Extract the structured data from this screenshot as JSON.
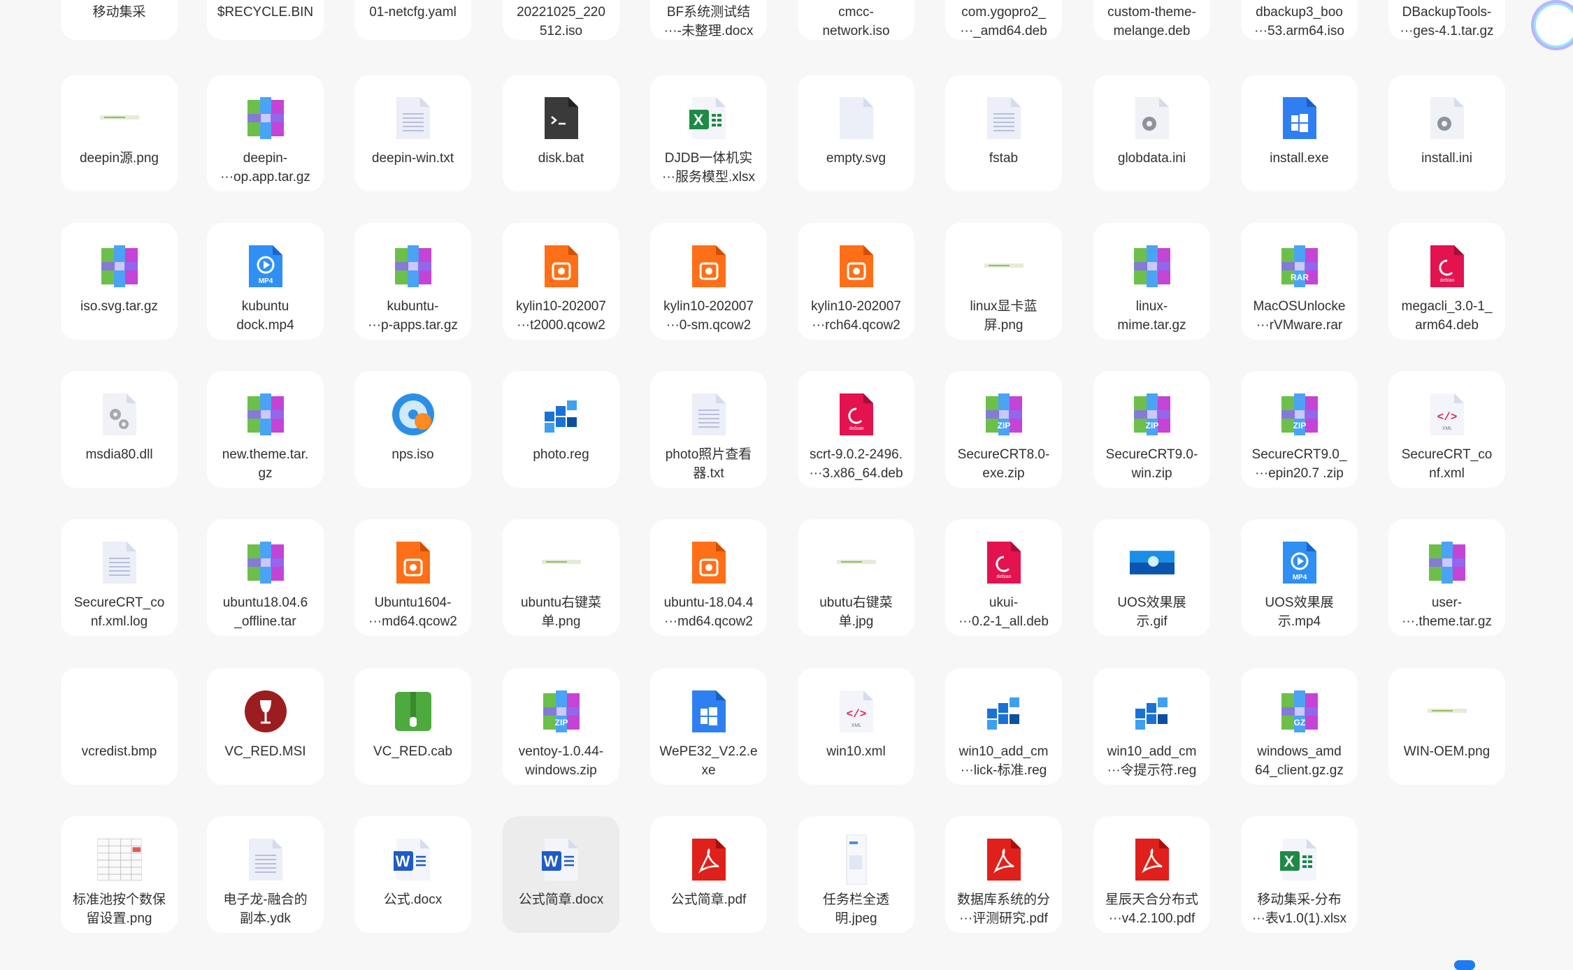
{
  "files": [
    {
      "name": "移动集采",
      "icon": "folder-icon"
    },
    {
      "name": "$RECYCLE.BIN",
      "icon": "folder-icon"
    },
    {
      "name": "01-netcfg.yaml",
      "icon": "text-file-icon"
    },
    {
      "name": "20221025_220\n512.iso",
      "icon": "disc-icon"
    },
    {
      "name": "BF系统测试结\n···-未整理.docx",
      "icon": "word-icon"
    },
    {
      "name": "cmcc-\nnetwork.iso",
      "icon": "disc-icon"
    },
    {
      "name": "com.ygopro2_\n···_amd64.deb",
      "icon": "deb-icon"
    },
    {
      "name": "custom-theme-\nmelange.deb",
      "icon": "deb-icon"
    },
    {
      "name": "dbackup3_boo\n···53.arm64.iso",
      "icon": "disc-icon"
    },
    {
      "name": "DBackupTools-\n···ges-4.1.tar.gz",
      "icon": "archive-icon"
    },
    {
      "name": "deepin源.png",
      "icon": "image-thumb-icon"
    },
    {
      "name": "deepin-\n···op.app.tar.gz",
      "icon": "archive-icon"
    },
    {
      "name": "deepin-win.txt",
      "icon": "text-file-icon"
    },
    {
      "name": "disk.bat",
      "icon": "terminal-icon"
    },
    {
      "name": "DJDB一体机实\n···服务模型.xlsx",
      "icon": "excel-icon"
    },
    {
      "name": "empty.svg",
      "icon": "blank-file-icon"
    },
    {
      "name": "fstab",
      "icon": "text-file-icon"
    },
    {
      "name": "globdata.ini",
      "icon": "config-icon"
    },
    {
      "name": "install.exe",
      "icon": "windows-exe-icon"
    },
    {
      "name": "install.ini",
      "icon": "config-icon"
    },
    {
      "name": "iso.svg.tar.gz",
      "icon": "archive-icon"
    },
    {
      "name": "kubuntu\ndock.mp4",
      "icon": "mp4-icon"
    },
    {
      "name": "kubuntu-\n···p-apps.tar.gz",
      "icon": "archive-icon"
    },
    {
      "name": "kylin10-202007\n···t2000.qcow2",
      "icon": "disk-image-icon"
    },
    {
      "name": "kylin10-202007\n···0-sm.qcow2",
      "icon": "disk-image-icon"
    },
    {
      "name": "kylin10-202007\n···rch64.qcow2",
      "icon": "disk-image-icon"
    },
    {
      "name": "linux显卡蓝\n屏.png",
      "icon": "image-thumb-icon"
    },
    {
      "name": "linux-\nmime.tar.gz",
      "icon": "archive-icon"
    },
    {
      "name": "MacOSUnlocke\n···rVMware.rar",
      "icon": "rar-icon"
    },
    {
      "name": "megacli_3.0-1_\narm64.deb",
      "icon": "deb-icon"
    },
    {
      "name": "msdia80.dll",
      "icon": "dll-icon"
    },
    {
      "name": "new.theme.tar.\ngz",
      "icon": "archive-icon"
    },
    {
      "name": "nps.iso",
      "icon": "disc-burner-icon"
    },
    {
      "name": "photo.reg",
      "icon": "registry-icon"
    },
    {
      "name": "photo照片查看\n器.txt",
      "icon": "text-file-icon"
    },
    {
      "name": "scrt-9.0.2-2496.\n···3.x86_64.deb",
      "icon": "deb-icon"
    },
    {
      "name": "SecureCRT8.0-\nexe.zip",
      "icon": "zip-icon"
    },
    {
      "name": "SecureCRT9.0-\nwin.zip",
      "icon": "zip-icon"
    },
    {
      "name": "SecureCRT9.0_\n···epin20.7 .zip",
      "icon": "zip-icon"
    },
    {
      "name": "SecureCRT_co\nnf.xml",
      "icon": "xml-icon"
    },
    {
      "name": "SecureCRT_co\nnf.xml.log",
      "icon": "text-file-icon"
    },
    {
      "name": "ubuntu18.04.6\n_offline.tar",
      "icon": "archive-icon"
    },
    {
      "name": "Ubuntu1604-\n···md64.qcow2",
      "icon": "disk-image-icon"
    },
    {
      "name": "ubuntu右键菜\n单.png",
      "icon": "image-thumb-icon"
    },
    {
      "name": "ubuntu-18.04.4\n···md64.qcow2",
      "icon": "disk-image-icon"
    },
    {
      "name": "ubutu右键菜\n单.jpg",
      "icon": "image-thumb-icon"
    },
    {
      "name": "ukui-\n···0.2-1_all.deb",
      "icon": "deb-icon"
    },
    {
      "name": "UOS效果展\n示.gif",
      "icon": "gif-thumb-icon"
    },
    {
      "name": "UOS效果展\n示.mp4",
      "icon": "mp4-icon"
    },
    {
      "name": "user-\n···.theme.tar.gz",
      "icon": "archive-icon"
    },
    {
      "name": "vcredist.bmp",
      "icon": "blank-thumb-icon"
    },
    {
      "name": "VC_RED.MSI",
      "icon": "wine-icon"
    },
    {
      "name": "VC_RED.cab",
      "icon": "cab-icon"
    },
    {
      "name": "ventoy-1.0.44-\nwindows.zip",
      "icon": "zip-icon"
    },
    {
      "name": "WePE32_V2.2.e\nxe",
      "icon": "windows-exe-icon"
    },
    {
      "name": "win10.xml",
      "icon": "xml-icon"
    },
    {
      "name": "win10_add_cm\n···lick-标准.reg",
      "icon": "registry-icon"
    },
    {
      "name": "win10_add_cm\n···令提示符.reg",
      "icon": "registry-icon"
    },
    {
      "name": "windows_amd\n64_client.gz.gz",
      "icon": "gz-icon"
    },
    {
      "name": "WIN-OEM.png",
      "icon": "image-thumb-icon"
    },
    {
      "name": "标准池按个数保\n留设置.png",
      "icon": "spreadsheet-thumb-icon"
    },
    {
      "name": "电子龙-融合的\n副本.ydk",
      "icon": "text-file-icon"
    },
    {
      "name": "公式.docx",
      "icon": "word-icon"
    },
    {
      "name": "公式简章.docx",
      "icon": "word-icon"
    },
    {
      "name": "公式简章.pdf",
      "icon": "pdf-icon"
    },
    {
      "name": "任务栏全透\n明.jpeg",
      "icon": "taskbar-thumb-icon"
    },
    {
      "name": "数据库系统的分\n···评测研究.pdf",
      "icon": "pdf-icon"
    },
    {
      "name": "星辰天合分布式\n···v4.2.100.pdf",
      "icon": "pdf-icon"
    },
    {
      "name": "移动集采-分布\n···表v1.0(1).xlsx",
      "icon": "excel-icon"
    }
  ],
  "selected_index": 63,
  "colors": {
    "background": "#f7f7f7",
    "card": "#ffffff",
    "selected": "#ececec",
    "accent": "#1f7bf2"
  }
}
